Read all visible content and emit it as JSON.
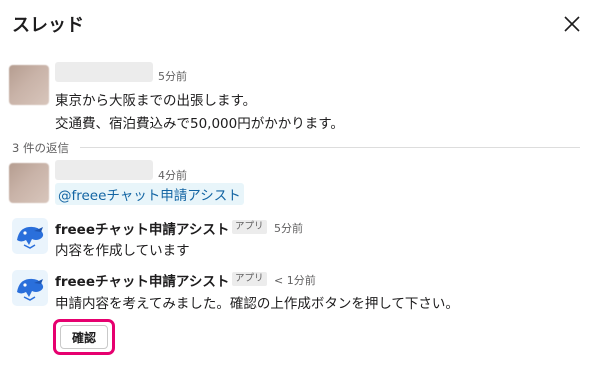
{
  "header": {
    "title": "スレッド"
  },
  "parent_message": {
    "time": "5分前",
    "lines": [
      "東京から大阪までの出張します。",
      "交通費、宿泊費込みで50,000円がかかります。"
    ]
  },
  "replies_divider": {
    "label": "3 件の返信"
  },
  "replies": [
    {
      "time": "4分前",
      "mention": "@freeeチャット申請アシスト"
    },
    {
      "sender": "freeeチャット申請アシスト",
      "badge": "アプリ",
      "time": "5分前",
      "text": "内容を作成しています"
    },
    {
      "sender": "freeeチャット申請アシスト",
      "badge": "アプリ",
      "time": "< 1分前",
      "text": "申請内容を考えてみました。確認の上作成ボタンを押して下さい。",
      "button_label": "確認"
    }
  ],
  "colors": {
    "highlight": "#e6006f",
    "mention_text": "#1264a3",
    "mention_bg": "#e8f5fa"
  }
}
